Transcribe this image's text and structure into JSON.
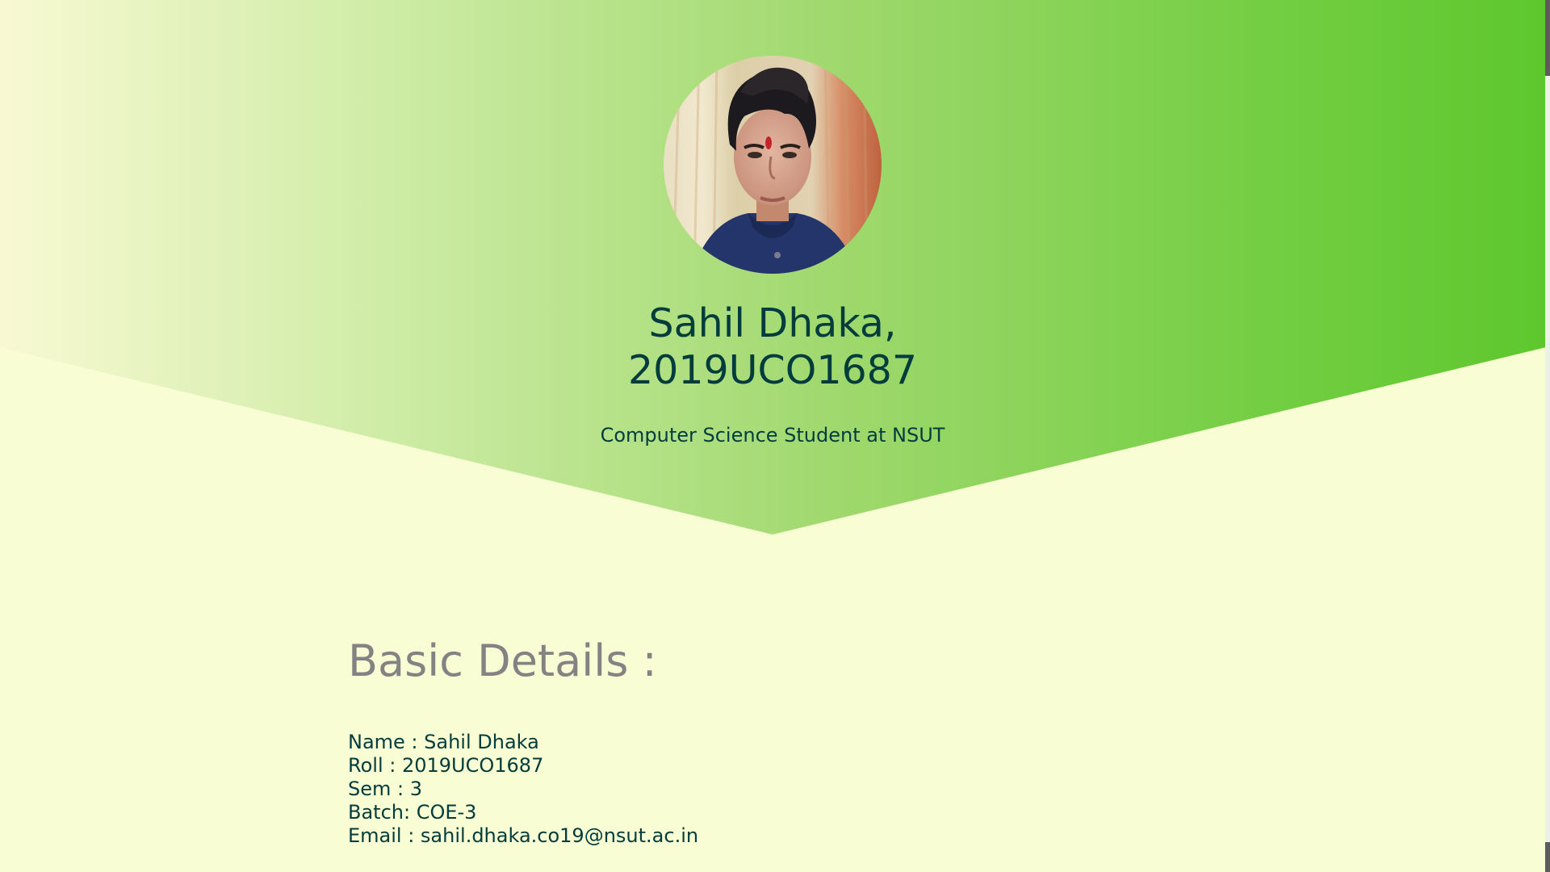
{
  "hero": {
    "name_line1": "Sahil Dhaka,",
    "name_line2": "2019UCO1687",
    "subtitle": "Computer Science Student at NSUT"
  },
  "basic_details": {
    "heading": "Basic Details :",
    "items": [
      "Name : Sahil Dhaka",
      "Roll : 2019UCO1687",
      "Sem : 3",
      "Batch: COE-3",
      "Email : sahil.dhaka.co19@nsut.ac.in"
    ]
  },
  "colors": {
    "background": "#f9fdd3",
    "gradient_start": "#f8f9d3",
    "gradient_end": "#5ec72e",
    "title_text": "#033c3c",
    "heading_grey": "#838383"
  },
  "icons": {
    "avatar": "profile-photo"
  }
}
